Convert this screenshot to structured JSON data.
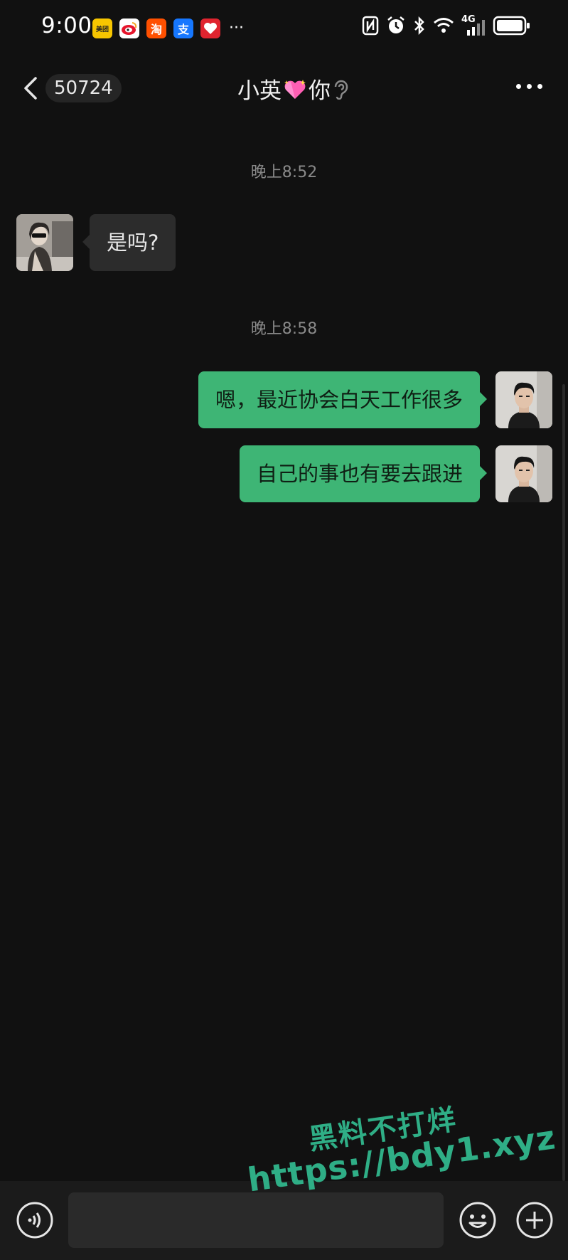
{
  "status_bar": {
    "time": "9:00",
    "app_icons": [
      {
        "name": "meituan-icon",
        "label": "美团",
        "color": "#f7c600"
      },
      {
        "name": "weibo-icon",
        "label": "",
        "color": "#f5a623"
      },
      {
        "name": "taobao-icon",
        "label": "淘",
        "color": "#ff5000"
      },
      {
        "name": "alipay-icon",
        "label": "支",
        "color": "#1677ff"
      },
      {
        "name": "heart-app-icon",
        "label": "",
        "color": "#e0242f"
      }
    ],
    "more": "···",
    "network": "4G"
  },
  "nav": {
    "unread_count": "50724",
    "title_left": "小英",
    "title_right": "你"
  },
  "messages": [
    {
      "type": "time",
      "text": "晚上8:52"
    },
    {
      "type": "in",
      "text": "是吗?"
    },
    {
      "type": "time",
      "text": "晚上8:58"
    },
    {
      "type": "out",
      "text": "嗯，最近协会白天工作很多"
    },
    {
      "type": "out",
      "text": "自己的事也有要去跟进"
    }
  ],
  "input": {
    "value": "",
    "placeholder": ""
  },
  "watermark": {
    "line1": "黑料不打烊",
    "line2": "https://bdy1.xyz"
  },
  "colors": {
    "background": "#111111",
    "outgoing_bubble": "#3eb575",
    "incoming_bubble": "#2c2c2c",
    "watermark": "#2fae86"
  }
}
